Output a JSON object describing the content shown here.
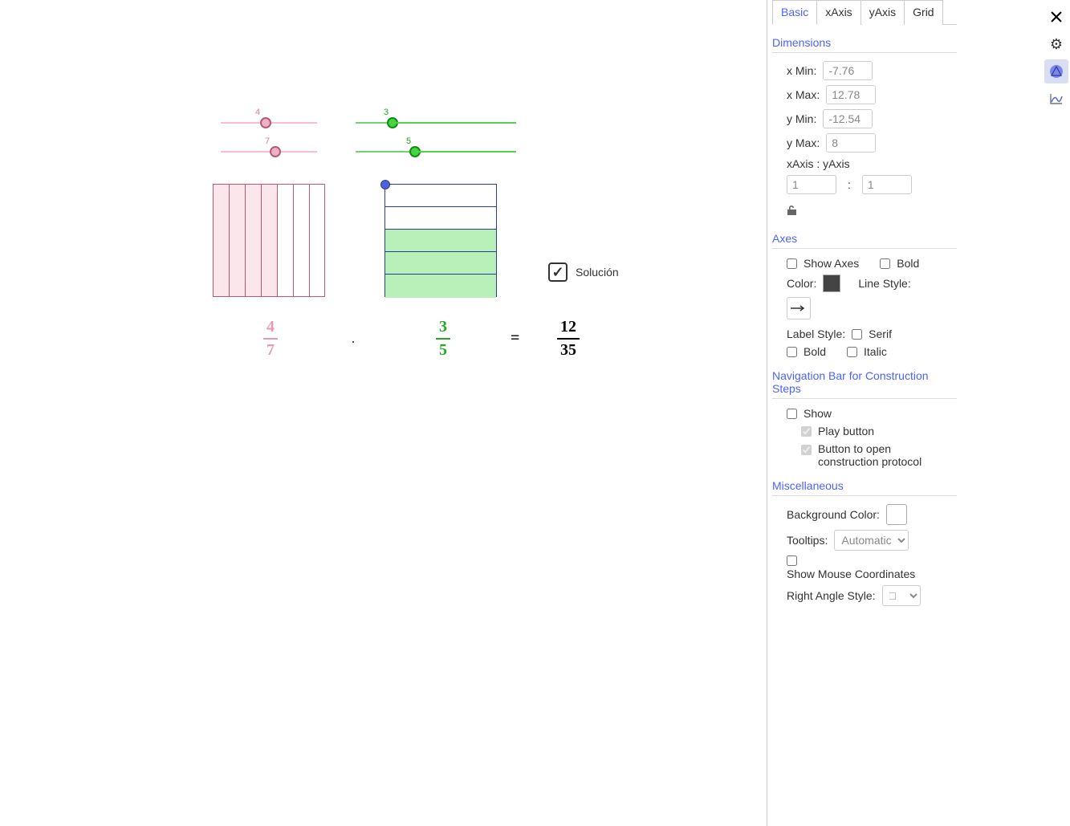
{
  "canvas": {
    "slider1": {
      "value": "4"
    },
    "slider2": {
      "value": "7"
    },
    "slider3": {
      "value": "3"
    },
    "slider4": {
      "value": "5"
    },
    "solucion_label": "Solución",
    "solucion_checked": true,
    "frac1": {
      "num": "4",
      "den": "7"
    },
    "dot": "·",
    "frac2": {
      "num": "3",
      "den": "5"
    },
    "eq": "=",
    "frac3": {
      "num": "12",
      "den": "35"
    }
  },
  "tabs": {
    "basic": "Basic",
    "xaxis": "xAxis",
    "yaxis": "yAxis",
    "grid": "Grid"
  },
  "dimensions": {
    "title": "Dimensions",
    "xmin_label": "x Min:",
    "xmin": "-7.76",
    "xmax_label": "x Max:",
    "xmax": "12.78",
    "ymin_label": "y Min:",
    "ymin": "-12.54",
    "ymax_label": "y Max:",
    "ymax": "8",
    "ratio_label": "xAxis : yAxis",
    "ratio_x": "1",
    "ratio_sep": ":",
    "ratio_y": "1"
  },
  "axes": {
    "title": "Axes",
    "show_axes": "Show Axes",
    "bold": "Bold",
    "color_label": "Color:",
    "line_style_label": "Line Style:",
    "label_style_label": "Label Style:",
    "serif": "Serif",
    "bold2": "Bold",
    "italic": "Italic"
  },
  "nav": {
    "title": "Navigation Bar for Construction Steps",
    "show": "Show",
    "play": "Play button",
    "protocol": "Button to open construction protocol"
  },
  "misc": {
    "title": "Miscellaneous",
    "bg_label": "Background Color:",
    "tooltips_label": "Tooltips:",
    "tooltips_value": "Automatic",
    "mouse": "Show Mouse Coordinates",
    "right_angle_label": "Right Angle Style:",
    "right_angle_value": "□"
  }
}
